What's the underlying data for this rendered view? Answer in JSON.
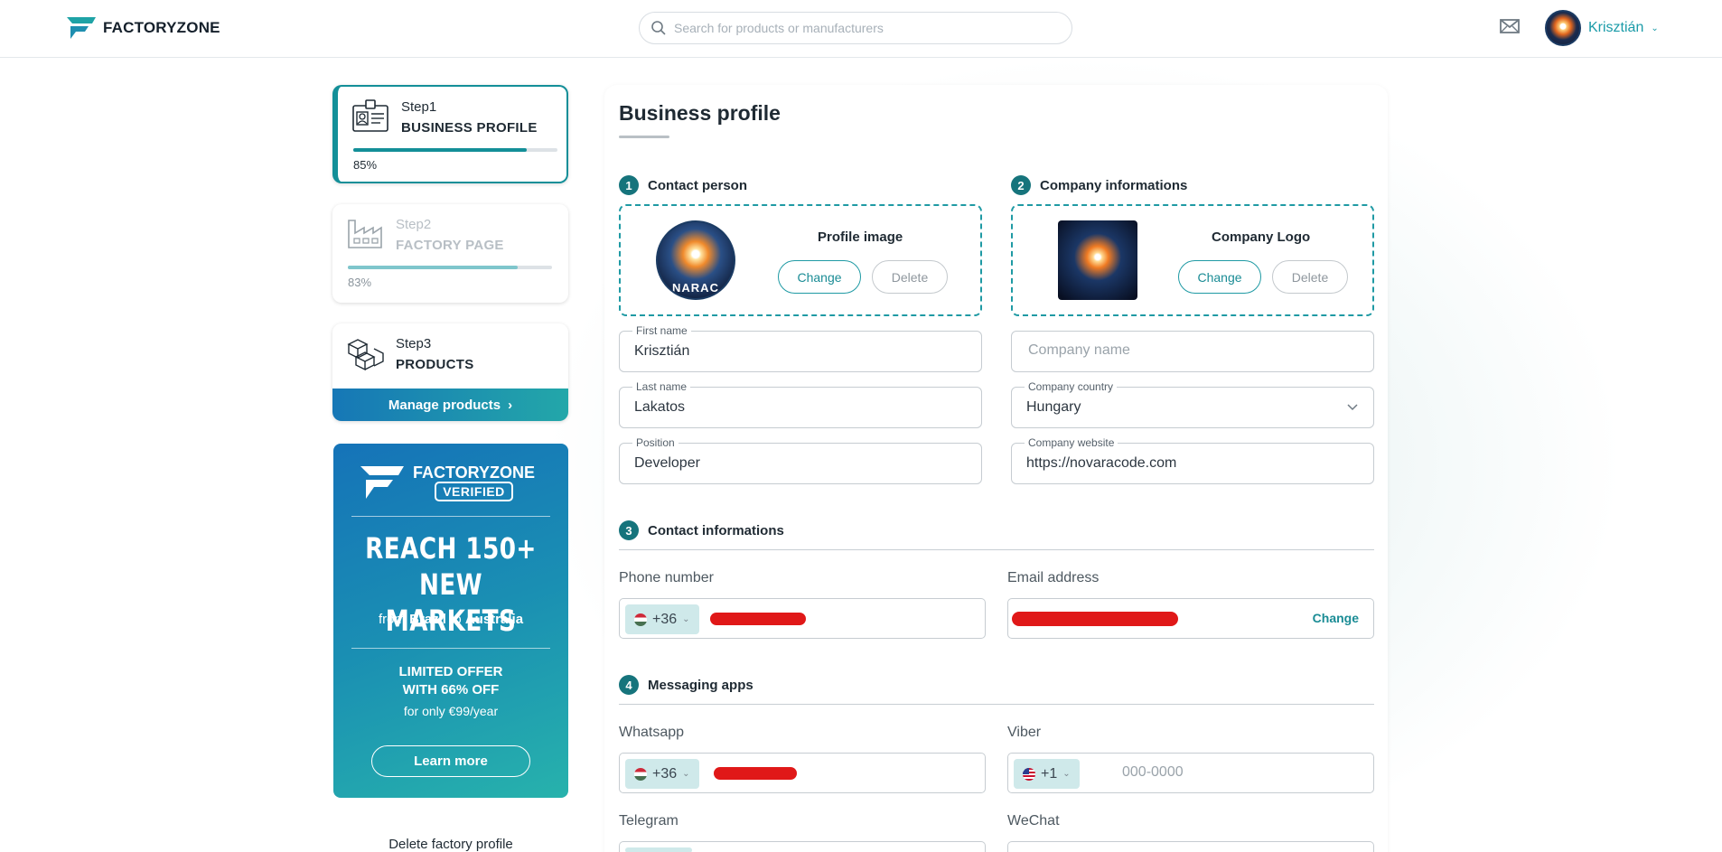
{
  "header": {
    "brand": "FACTORYZONE",
    "search_placeholder": "Search for products or manufacturers",
    "user_name": "Krisztián",
    "colors": {
      "accent": "#1a9ba8",
      "brand_dark": "#15202b"
    }
  },
  "sidebar": {
    "steps": [
      {
        "num": "Step1",
        "title": "BUSINESS PROFILE",
        "progress": "85%",
        "progress_value": 85,
        "icon": "id-card-icon"
      },
      {
        "num": "Step2",
        "title": "FACTORY PAGE",
        "progress": "83%",
        "progress_value": 83,
        "icon": "factory-icon"
      },
      {
        "num": "Step3",
        "title": "PRODUCTS",
        "action": "Manage products",
        "icon": "boxes-icon"
      }
    ],
    "promo": {
      "brand": "FACTORYZONE",
      "badge": "VERIFIED",
      "headline_1": "REACH 150+",
      "headline_2": "NEW MARKETS",
      "from_word": "from",
      "from_place": "Brazil",
      "to_word": "to",
      "to_place": "Australia",
      "offer_1": "LIMITED OFFER",
      "offer_2": "WITH 66% OFF",
      "price": "for only €99/year",
      "button": "Learn more"
    },
    "delete_profile": "Delete factory profile"
  },
  "main": {
    "title": "Business profile",
    "sections": {
      "contact_person": {
        "num": "1",
        "label": "Contact person"
      },
      "company_info": {
        "num": "2",
        "label": "Company informations"
      },
      "contact_info": {
        "num": "3",
        "label": "Contact informations"
      },
      "messaging": {
        "num": "4",
        "label": "Messaging apps"
      }
    },
    "profile_image": {
      "label": "Profile image",
      "change": "Change",
      "delete": "Delete",
      "avatar_text": "NARAC"
    },
    "company_logo": {
      "label": "Company Logo",
      "change": "Change",
      "delete": "Delete"
    },
    "fields": {
      "first_name": {
        "label": "First name",
        "value": "Krisztián"
      },
      "last_name": {
        "label": "Last name",
        "value": "Lakatos"
      },
      "position": {
        "label": "Position",
        "value": "Developer"
      },
      "company_name": {
        "placeholder": "Company name"
      },
      "company_country": {
        "label": "Company country",
        "value": "Hungary"
      },
      "company_website": {
        "label": "Company website",
        "value": "https://novaracode.com"
      }
    },
    "contact": {
      "phone_label": "Phone number",
      "phone_code": "+36",
      "email_label": "Email address",
      "email_change": "Change"
    },
    "messaging_apps": {
      "whatsapp_label": "Whatsapp",
      "whatsapp_code": "+36",
      "viber_label": "Viber",
      "viber_code": "+1",
      "viber_placeholder": "000-0000",
      "telegram_label": "Telegram",
      "wechat_label": "WeChat"
    }
  }
}
